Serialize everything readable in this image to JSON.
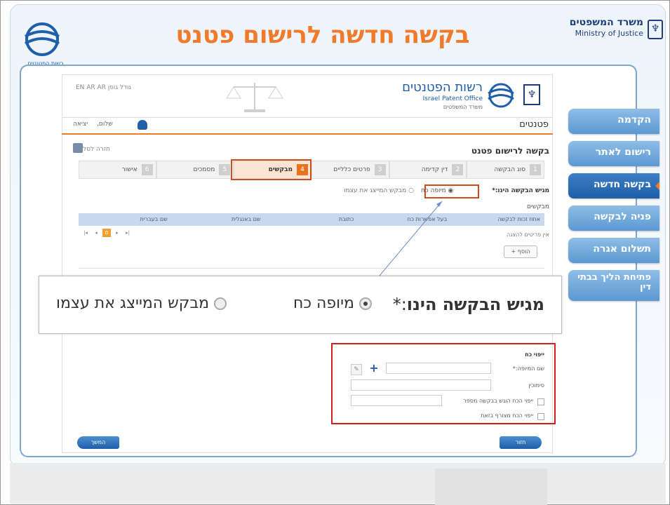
{
  "slide": {
    "title": "בקשה חדשה לרישום פטנט",
    "ministry_he": "משרד המשפטים",
    "ministry_en": "Ministry of Justice",
    "ipo_logo_text": "רשות הפטנטים"
  },
  "site_header": {
    "ipo_he": "רשות הפטנטים",
    "ipo_en": "Israel Patent Office",
    "ipo_sub": "משרד המשפטים",
    "top_links": "EN  AR  AR  גודל גופן"
  },
  "userbar": {
    "patents_logo": "פטנטים",
    "greeting": "שלום,",
    "logout": "יציאה"
  },
  "page": {
    "heading": "בקשה לרישום פטנט",
    "back_link": "חזרה לסל"
  },
  "steps": [
    {
      "num": "1",
      "label": "סוג הבקשה"
    },
    {
      "num": "2",
      "label": "דין קדימה"
    },
    {
      "num": "3",
      "label": "פרטים כלליים"
    },
    {
      "num": "4",
      "label": "מבקשים"
    },
    {
      "num": "5",
      "label": "מסמכים"
    },
    {
      "num": "6",
      "label": "אישור"
    }
  ],
  "submitter": {
    "label": "מגיש הבקשה הינו:*",
    "option_proxy": "מיופה כח",
    "option_self": "מבקש המייצג את עצמו"
  },
  "applicants": {
    "label": "מבקשים",
    "columns": [
      "שם בעברית",
      "שם באנגלית",
      "כתובת",
      "בעל אפשרות כח",
      "אחוז זכות לבקשה"
    ],
    "empty_text": "אין פריטים להצגה",
    "add_label": "הוסף +",
    "pager_current": "0"
  },
  "zoom": {
    "label_main": "מגיש הבקשה הינו",
    "label_suffix": ":*",
    "option_proxy": "מיופה כח",
    "option_self": "מבקש המייצג את עצמו"
  },
  "proxy": {
    "title": "ייפוי כח",
    "name_label": "שם המיופה:*",
    "signature_label": "סימוכין",
    "checkbox1": "ייפוי הכח הוגש בבקשה מספר",
    "checkbox2": "ייפוי הכח מצורף בזאת"
  },
  "buttons": {
    "next": "המשך",
    "back": "חזור"
  },
  "sidenav": [
    {
      "label": "הקדמה",
      "active": false
    },
    {
      "label": "רישום לאתר",
      "active": false
    },
    {
      "label": "בקשה חדשה",
      "active": true
    },
    {
      "label": "פניה לבקשה",
      "active": false
    },
    {
      "label": "תשלום אגרה",
      "active": false
    },
    {
      "label": "פתיחת הליך בבתי דין",
      "active": false
    }
  ],
  "colors": {
    "accent_orange": "#f07a2a",
    "brand_blue": "#1f5ea8",
    "highlight_red": "#d0201a"
  }
}
